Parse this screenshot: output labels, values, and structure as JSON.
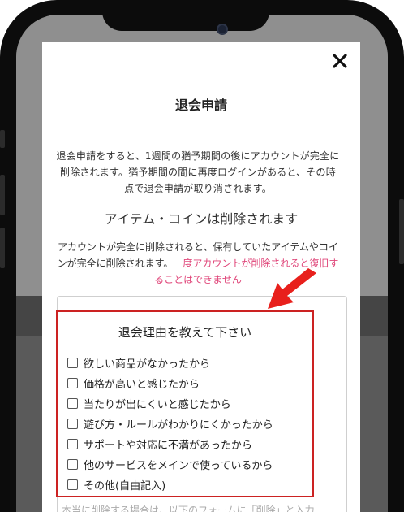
{
  "modal": {
    "title": "退会申請",
    "description": "退会申請をすると、1週間の猶予期間の後にアカウントが完全に削除されます。猶予期間の間に再度ログインがあると、その時点で退会申請が取り消されます。",
    "section_heading": "アイテム・コインは削除されます",
    "warning_text": "アカウントが完全に削除されると、保有していたアイテムやコインが完全に削除されます。",
    "warning_highlight": "一度アカウントが削除されると復旧することはできません",
    "reasons": {
      "title": "退会理由を教えて下さい",
      "options": [
        "欲しい商品がなかったから",
        "価格が高いと感じたから",
        "当たりが出にくいと感じたから",
        "遊び方・ルールがわかりにくかったから",
        "サポートや対応に不満があったから",
        "他のサービスをメインで使っているから",
        "その他(自由記入)"
      ]
    },
    "footer_partial": "本当に削除する場合は、以下のフォームに「削除」と入力"
  },
  "icons": {
    "close": "close-icon",
    "annotation_arrow": "arrow-icon"
  },
  "colors": {
    "highlight_pink": "#e0487b",
    "annotation_red": "#cc2222",
    "arrow_red": "#e8201c"
  }
}
